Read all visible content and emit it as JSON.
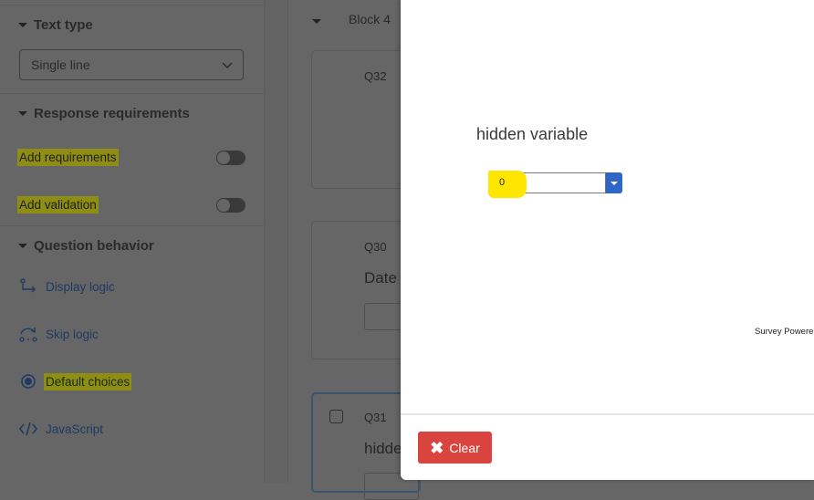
{
  "sidebar": {
    "text_type": {
      "heading": "Text type",
      "select_value": "Single line"
    },
    "response_requirements": {
      "heading": "Response requirements",
      "items": [
        {
          "label": "Add requirements",
          "toggle_on": false,
          "highlighted": true
        },
        {
          "label": "Add validation",
          "toggle_on": false,
          "highlighted": true
        }
      ]
    },
    "question_behavior": {
      "heading": "Question behavior",
      "items": [
        {
          "label": "Display logic",
          "icon": "display-logic-icon"
        },
        {
          "label": "Skip logic",
          "icon": "skip-logic-icon"
        },
        {
          "label": "Default choices",
          "icon": "radio-selected-icon",
          "highlighted": true
        },
        {
          "label": "JavaScript",
          "icon": "code-icon"
        }
      ]
    }
  },
  "survey": {
    "block_title": "Block 4",
    "questions": [
      {
        "number": "Q32",
        "text": ""
      },
      {
        "number": "Q30",
        "text": "Date"
      },
      {
        "number": "Q31",
        "text": "hidde"
      }
    ]
  },
  "preview": {
    "question_text": "hidden variable",
    "select_value": "0",
    "powered_by": "Survey Powere",
    "clear_label": "Clear"
  },
  "colors": {
    "highlight": "#ffe600",
    "clear_button": "#d9443f",
    "select_button": "#2e66c8",
    "link_blue": "#1f3a63"
  }
}
